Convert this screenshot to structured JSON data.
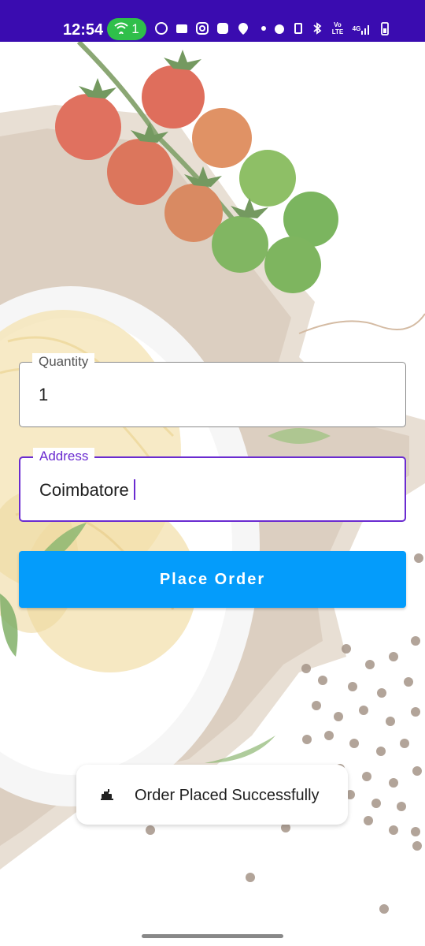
{
  "status_bar": {
    "time": "12:54",
    "hotspot_count": "1",
    "icons_left": [
      "whatsapp-icon",
      "android-icon",
      "instagram-icon",
      "app-icon",
      "location-icon"
    ],
    "icons_right": [
      "alarm-icon",
      "vibrate-icon",
      "bluetooth-icon",
      "volte-icon",
      "4g-signal-icon",
      "battery-icon"
    ],
    "volte_label": "Vo LTE",
    "network_label": "4G"
  },
  "form": {
    "quantity": {
      "label": "Quantity",
      "value": "1"
    },
    "address": {
      "label": "Address",
      "value": "Coimbatore"
    },
    "submit_label": "Place Order"
  },
  "toast": {
    "message": "Order Placed Successfully"
  },
  "colors": {
    "status_bar": "#3a0cb0",
    "accent": "#6a2bd0",
    "button": "#049cfb"
  }
}
